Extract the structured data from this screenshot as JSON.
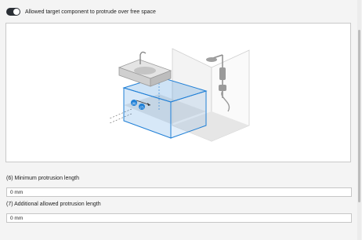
{
  "toggle": {
    "label": "Allowed target component to protrude over free space",
    "enabled": true
  },
  "illustration": {
    "badges": [
      "(6)",
      "(7)"
    ],
    "accent": "#1f7fd6"
  },
  "fields": [
    {
      "label": "(6) Minimum protrusion length",
      "value": "0 mm"
    },
    {
      "label": "(7) Additional allowed protrusion length",
      "value": "0 mm"
    }
  ]
}
